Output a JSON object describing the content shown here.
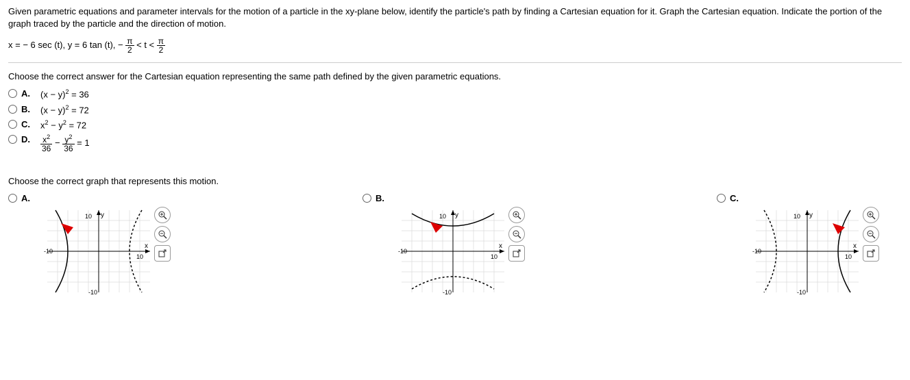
{
  "problem": {
    "intro": "Given parametric equations and parameter intervals for the motion of a particle in the xy-plane below, identify the particle's path by finding a Cartesian equation for it. Graph the Cartesian equation. Indicate the portion of the graph traced by the particle and the direction of motion.",
    "equation_prefix": "x = − 6 sec (t), y = 6 tan (t),  − ",
    "equation_mid": " < t < ",
    "frac_num": "π",
    "frac_den": "2"
  },
  "cartesian": {
    "prompt": "Choose the correct answer for the Cartesian equation representing the same path defined by the given parametric equations.",
    "options": [
      {
        "label": "A.",
        "text_pre": "(x − y)",
        "text_post": " = 36",
        "has_sq": true,
        "type": "simple"
      },
      {
        "label": "B.",
        "text_pre": "(x − y)",
        "text_post": " = 72",
        "has_sq": true,
        "type": "simple"
      },
      {
        "label": "C.",
        "text_pre": "x",
        "text_mid": " − y",
        "text_post": " = 72",
        "type": "double_sq"
      },
      {
        "label": "D.",
        "type": "frac_eq",
        "n1": "x",
        "d1": "36",
        "n2": "y",
        "d2": "36",
        "rhs": " = 1"
      }
    ]
  },
  "graph": {
    "prompt": "Choose the correct graph that represents this motion.",
    "options": [
      {
        "label": "A."
      },
      {
        "label": "B."
      },
      {
        "label": "C."
      }
    ],
    "axis": {
      "y_top": "10",
      "y_bot": "-10",
      "x_left": "-10",
      "x_right": "10",
      "y_label": "y",
      "x_label": "x"
    }
  },
  "icons": {
    "zoom_in": "zoom-in-icon",
    "zoom_out": "zoom-out-icon",
    "popout": "popout-icon"
  }
}
